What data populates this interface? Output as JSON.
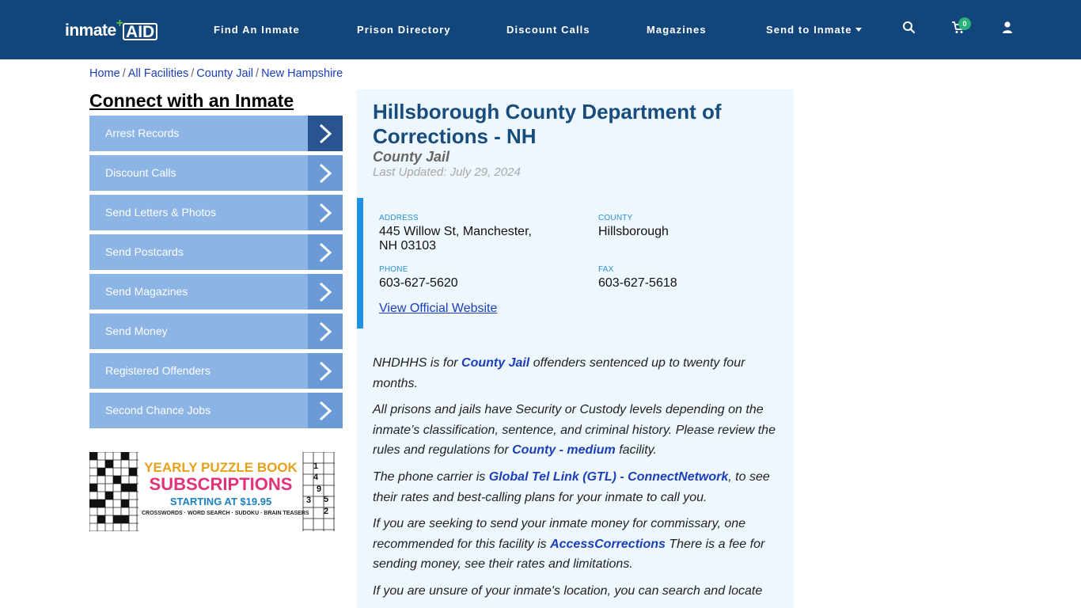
{
  "header": {
    "logo_text_1": "inmate",
    "logo_text_2": "AID",
    "logo_plus": "+",
    "nav": [
      "Find An Inmate",
      "Prison Directory",
      "Discount Calls",
      "Magazines",
      "Send to Inmate"
    ],
    "cart_count": "0",
    "bg_color": "#12457a"
  },
  "breadcrumb": {
    "items": [
      "Home",
      "All Facilities",
      "County Jail",
      "New Hampshire"
    ],
    "sep": "/"
  },
  "sidebar": {
    "title": "Connect with an Inmate",
    "items": [
      "Arrest Records",
      "Discount Calls",
      "Send Letters & Photos",
      "Send Postcards",
      "Send Magazines",
      "Send Money",
      "Registered Offenders",
      "Second Chance Jobs"
    ]
  },
  "ad": {
    "line1": "YEARLY PUZZLE BOOK",
    "line2": "SUBSCRIPTIONS",
    "line3": "STARTING AT $19.95",
    "line4": "CROSSWORDS · WORD SEARCH · SUDOKU · BRAIN TEASERS",
    "digits": [
      "1",
      "4",
      "9",
      "5",
      "2",
      "3"
    ]
  },
  "facility": {
    "title": "Hillsborough County Department of Corrections - NH",
    "type": "County Jail",
    "updated": "Last Updated: July 29, 2024",
    "address_label": "ADDRESS",
    "address_line1": "445 Willow St, Manchester,",
    "address_line2": "NH 03103",
    "county_label": "COUNTY",
    "county": "Hillsborough",
    "phone_label": "PHONE",
    "phone": "603-627-5620",
    "fax_label": "FAX",
    "fax": "603-627-5618",
    "website_link": "View Official Website"
  },
  "content": {
    "p1_a": "NHDHHS is for ",
    "p1_link": "County Jail",
    "p1_b": " offenders sentenced up to twenty four months.",
    "p2_a": "All prisons and jails have Security or Custody levels depending on the inmate’s classification, sentence, and criminal history. Please review the rules and regulations for ",
    "p2_link": "County - medium",
    "p2_b": " facility.",
    "p3_a": "The phone carrier is ",
    "p3_link": "Global Tel Link (GTL) - ConnectNetwork",
    "p3_b": ", to see their rates and best-calling plans for your inmate to call you.",
    "p4_a": "If you are seeking to send your inmate money for commissary, one recommended for this facility is ",
    "p4_link": "AccessCorrections",
    "p4_b": " There is a fee for sending money, see their rates and limitations.",
    "p5_a": "If you are unsure of your inmate's location, you can search and locate"
  }
}
